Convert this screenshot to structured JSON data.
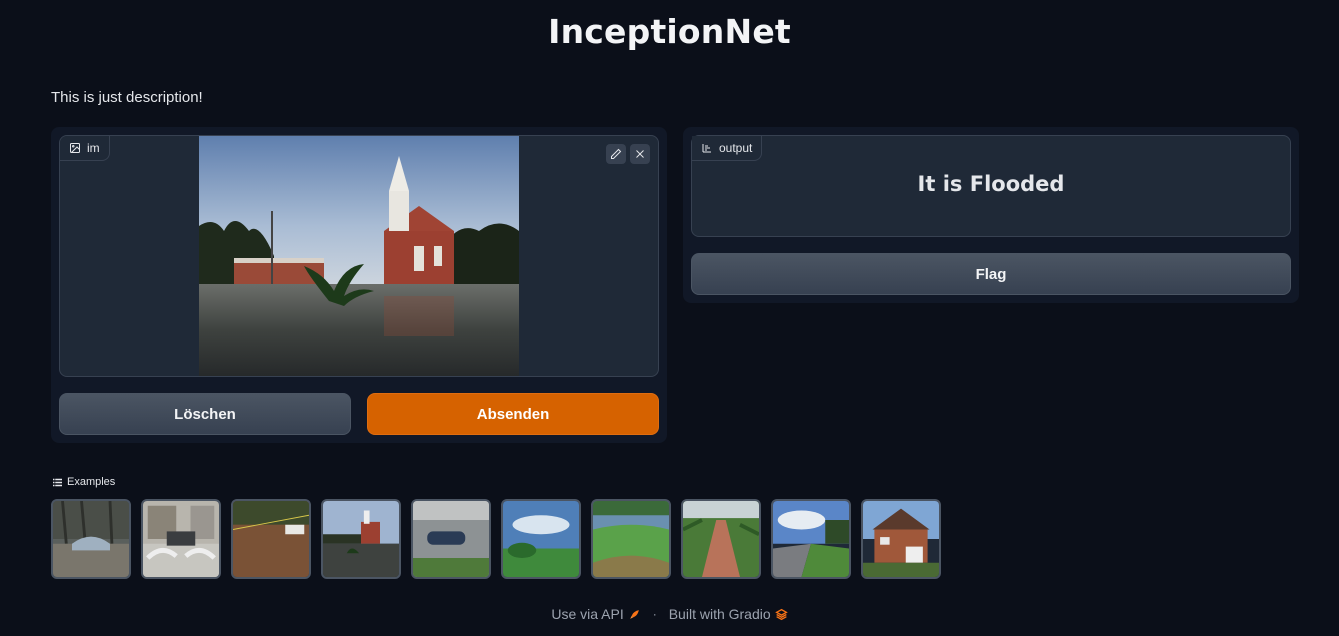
{
  "page": {
    "title": "InceptionNet",
    "description": "This is just description!"
  },
  "input": {
    "label": "im",
    "edit_icon": "pencil-icon",
    "clear_icon": "close-icon"
  },
  "buttons": {
    "clear": "Löschen",
    "submit": "Absenden",
    "flag": "Flag"
  },
  "output": {
    "label": "output",
    "value": "It is Flooded"
  },
  "examples": {
    "label": "Examples",
    "items": [
      "flooded-car-in-forest",
      "car-driving-through-flood",
      "flooded-field",
      "flooded-church",
      "flooded-car-street",
      "green-field-blue-sky",
      "green-valley",
      "dirt-path-plants",
      "suburban-road",
      "brick-house"
    ]
  },
  "footer": {
    "api_link": "Use via API",
    "separator": "·",
    "built_with": "Built with Gradio"
  },
  "colors": {
    "background": "#0b0f19",
    "panel": "#111827",
    "block": "#1f2937",
    "primary": "#d66200",
    "secondary": "#4b5563"
  }
}
